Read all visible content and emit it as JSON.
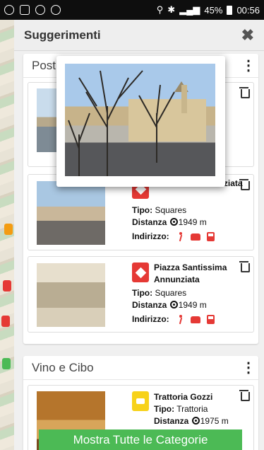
{
  "status_bar": {
    "battery": "45%",
    "time": "00:56"
  },
  "dialog": {
    "title": "Suggerimenti",
    "close_label": "✖"
  },
  "sections": [
    {
      "title": "Post",
      "menu_label": "⋮",
      "items": [
        {
          "name": "Piazza Ss. Annunziata",
          "type_label": "Tipo:",
          "type": "Squares",
          "distance_label": "Distanza",
          "distance": "1949 m",
          "address_label": "Indirizzo:"
        },
        {
          "name": "Piazza Santissima Annunziata",
          "type_label": "Tipo:",
          "type": "Squares",
          "distance_label": "Distanza",
          "distance": "1949 m",
          "address_label": "Indirizzo:"
        }
      ]
    },
    {
      "title": "Vino e Cibo",
      "menu_label": "⋮",
      "items": [
        {
          "name": "Trattoria Gozzi",
          "type_label": "Tipo:",
          "type": "Trattoria",
          "distance_label": "Distanza",
          "distance": "1975 m"
        }
      ]
    }
  ],
  "bottom_button": {
    "label": "Mostra Tutte le Categorie"
  },
  "colors": {
    "accent_red": "#e53935",
    "accent_green": "#4cba55",
    "accent_yellow": "#f7d21a"
  }
}
